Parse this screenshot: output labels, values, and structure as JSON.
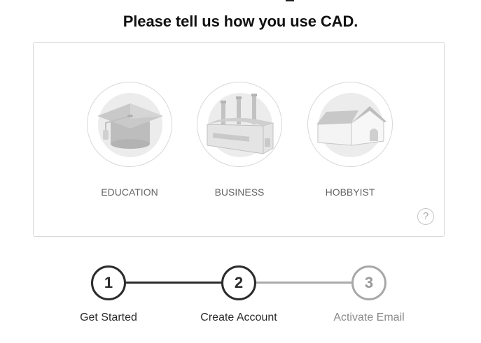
{
  "title": "Please tell us how you use CAD.",
  "options": [
    {
      "label": "EDUCATION",
      "icon": "graduation-cap-icon"
    },
    {
      "label": "BUSINESS",
      "icon": "factory-icon"
    },
    {
      "label": "HOBBYIST",
      "icon": "house-icon"
    }
  ],
  "help": {
    "label": "?",
    "icon": "help-icon"
  },
  "steps": [
    {
      "number": "1",
      "label": "Get Started",
      "state": "done"
    },
    {
      "number": "2",
      "label": "Create Account",
      "state": "current"
    },
    {
      "number": "3",
      "label": "Activate Email",
      "state": "pending"
    }
  ],
  "colors": {
    "active": "#2b2b2b",
    "inactive": "#aaaaaa",
    "label_gray": "#666666"
  }
}
